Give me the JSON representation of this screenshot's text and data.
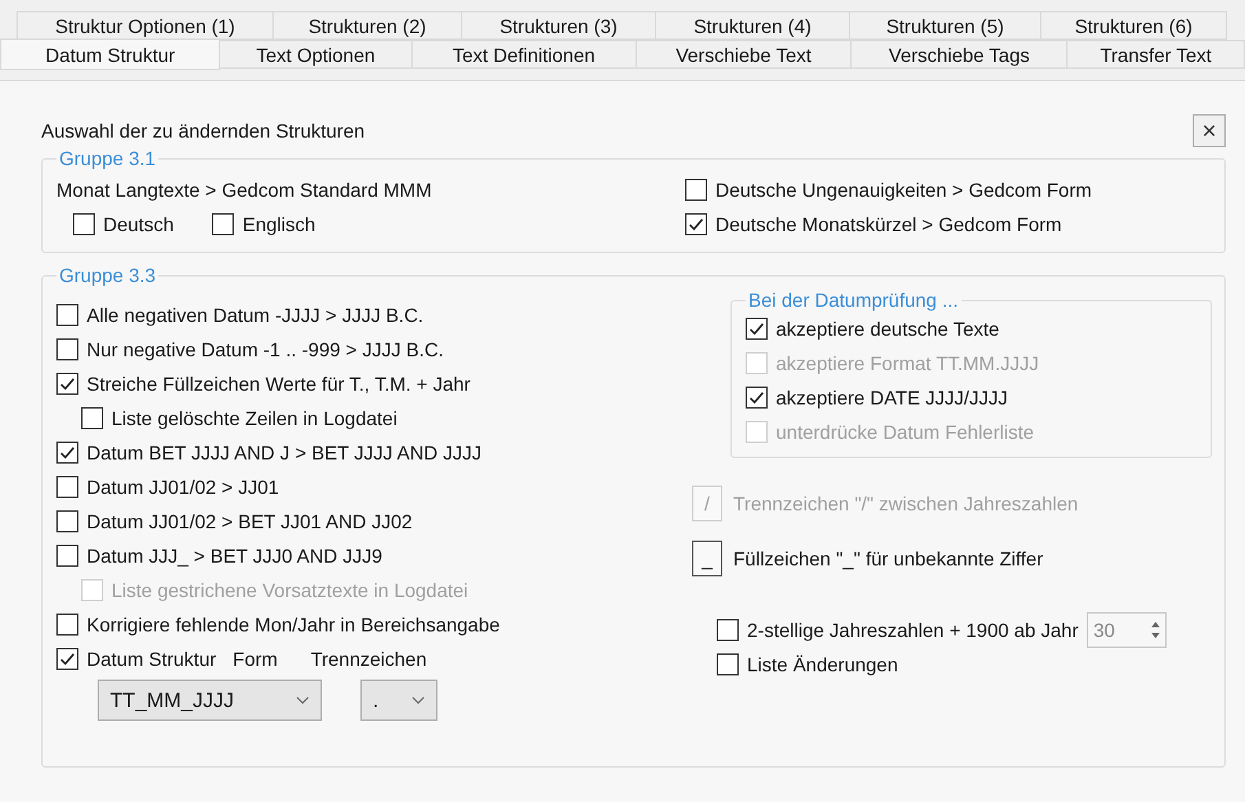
{
  "tab_rows": [
    [
      {
        "label": "Struktur Optionen (1)",
        "selected": false
      },
      {
        "label": "Strukturen (2)",
        "selected": false
      },
      {
        "label": "Strukturen (3)",
        "selected": false
      },
      {
        "label": "Strukturen (4)",
        "selected": false
      },
      {
        "label": "Strukturen (5)",
        "selected": false
      },
      {
        "label": "Strukturen (6)",
        "selected": false
      }
    ],
    [
      {
        "label": "Datum Struktur",
        "selected": true
      },
      {
        "label": "Text Optionen",
        "selected": false
      },
      {
        "label": "Text Definitionen",
        "selected": false
      },
      {
        "label": "Verschiebe Text",
        "selected": false
      },
      {
        "label": "Verschiebe Tags",
        "selected": false
      },
      {
        "label": "Transfer Text",
        "selected": false
      }
    ]
  ],
  "heading": "Auswahl der zu ändernden Strukturen",
  "close_button": "×",
  "group_3_1": {
    "title": "Gruppe 3.1",
    "label": "Monat Langtexte > Gedcom Standard MMM",
    "language_options": [
      {
        "label": "Deutsch",
        "checked": false
      },
      {
        "label": "Englisch",
        "checked": false
      }
    ],
    "right_options": [
      {
        "label": "Deutsche Ungenauigkeiten > Gedcom Form",
        "checked": false
      },
      {
        "label": "Deutsche Monatskürzel > Gedcom Form",
        "checked": true
      }
    ]
  },
  "group_3_3": {
    "title": "Gruppe 3.3",
    "options": [
      {
        "label": "Alle negativen Datum -JJJJ > JJJJ B.C.",
        "checked": false,
        "disabled": false
      },
      {
        "label": "Nur negative Datum -1 .. -999 > JJJJ B.C.",
        "checked": false,
        "disabled": false
      },
      {
        "label": "Streiche Füllzeichen Werte für T., T.M. + Jahr",
        "checked": true,
        "disabled": false,
        "children": [
          {
            "label": "Liste gelöschte Zeilen in Logdatei",
            "checked": false,
            "disabled": false
          }
        ]
      },
      {
        "label": "Datum BET JJJJ AND J > BET JJJJ AND JJJJ",
        "checked": true,
        "disabled": false
      },
      {
        "label": "Datum JJ01/02 > JJ01",
        "checked": false,
        "disabled": false
      },
      {
        "label": "Datum JJ01/02 > BET JJ01 AND JJ02",
        "checked": false,
        "disabled": false
      },
      {
        "label": "Datum JJJ_ > BET JJJ0 AND JJJ9",
        "checked": false,
        "disabled": false,
        "children": [
          {
            "label": "Liste gestrichene Vorsatztexte in Logdatei",
            "checked": false,
            "disabled": true
          }
        ]
      },
      {
        "label": "Korrigiere fehlende Mon/Jahr in Bereichsangabe",
        "checked": false,
        "disabled": false
      }
    ],
    "date_structure": {
      "label": "Datum Struktur",
      "checked": true,
      "form_label": "Form",
      "separator_label": "Trennzeichen",
      "form_value": "TT_MM_JJJJ",
      "separator_value": "."
    },
    "check_group": {
      "title": "Bei der Datumprüfung ...",
      "options": [
        {
          "label": "akzeptiere deutsche Texte",
          "checked": true,
          "disabled": false
        },
        {
          "label": "akzeptiere Format TT.MM.JJJJ",
          "checked": false,
          "disabled": true
        },
        {
          "label": "akzeptiere DATE JJJJ/JJJJ",
          "checked": true,
          "disabled": false
        },
        {
          "label": "unterdrücke Datum Fehlerliste",
          "checked": false,
          "disabled": true
        }
      ]
    },
    "toggles": [
      {
        "glyph": "/",
        "label": "Trennzeichen \"/\" zwischen Jahreszahlen",
        "disabled": true
      },
      {
        "glyph": "_",
        "label": "Füllzeichen \"_\" für unbekannte Ziffer",
        "disabled": false
      }
    ],
    "year_option": {
      "label": "2-stellige Jahreszahlen + 1900 ab Jahr",
      "checked": false,
      "value": "30"
    },
    "list_changes": {
      "label": "Liste Änderungen",
      "checked": false
    }
  }
}
